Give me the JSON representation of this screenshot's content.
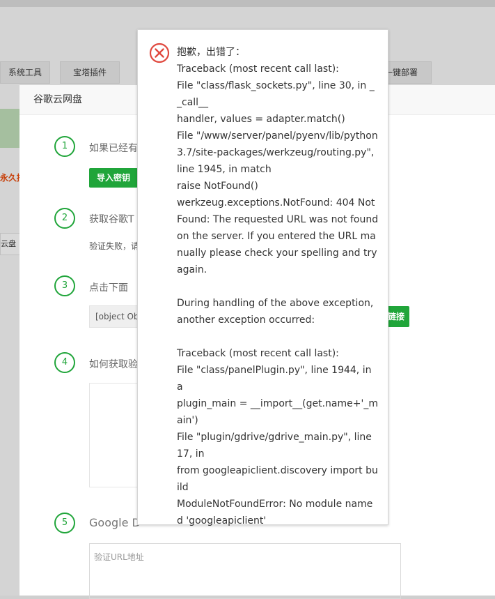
{
  "background": {
    "tabs": [
      "系统工具",
      "宝塔插件",
      "一键部署"
    ],
    "red_text": "永久授",
    "cloud_label": "云盘"
  },
  "panel": {
    "title": "谷歌云网盘",
    "steps": [
      {
        "num": "1",
        "title": "如果已经有"
      },
      {
        "num": "2",
        "title": "获取谷歌T"
      },
      {
        "num": "3",
        "title": "点击下面"
      },
      {
        "num": "4",
        "title": "如何获取验"
      },
      {
        "num": "5",
        "title": "Google D"
      }
    ],
    "import_key_button": "导入密钥",
    "verify_failed_text": "验证失败，请",
    "object_box_text": "[object Ob",
    "link_button": "链接",
    "url_placeholder": "验证URL地址"
  },
  "error": {
    "message": "抱歉，出错了：\nTraceback (most recent call last):\nFile \"class/flask_sockets.py\", line 30, in __call__\nhandler, values = adapter.match()\nFile \"/www/server/panel/pyenv/lib/python3.7/site-packages/werkzeug/routing.py\", line 1945, in match\nraise NotFound()\nwerkzeug.exceptions.NotFound: 404 Not Found: The requested URL was not found on the server. If you entered the URL manually please check your spelling and try again.\n\nDuring handling of the above exception, another exception occurred:\n\nTraceback (most recent call last):\nFile \"class/panelPlugin.py\", line 1944, in a\nplugin_main = __import__(get.name+'_main')\nFile \"plugin/gdrive/gdrive_main.py\", line 17, in\nfrom googleapiclient.discovery import build\nModuleNotFoundError: No module named 'googleapiclient'",
    "icon": "error-circle-x-icon",
    "icon_color": "#e0483e"
  }
}
